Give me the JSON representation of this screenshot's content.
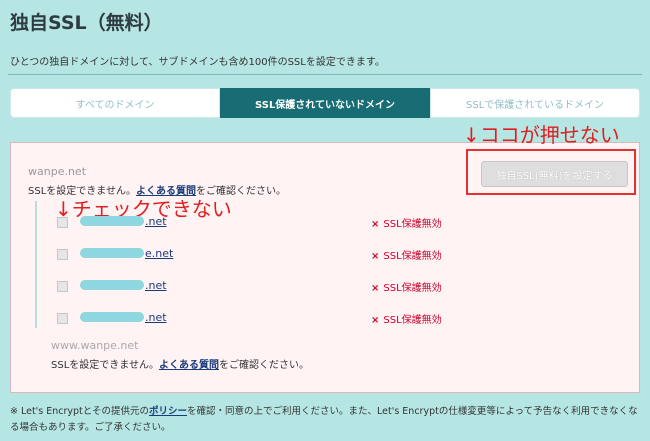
{
  "page_title": "独自SSL（無料）",
  "intro": "ひとつの独自ドメインに対して、サブドメインも含め100件のSSLを設定できます。",
  "tabs": [
    {
      "label": "すべてのドメイン"
    },
    {
      "label": "SSL保護されていないドメイン"
    },
    {
      "label": "SSLで保護されているドメイン"
    }
  ],
  "groups": [
    {
      "domain": "wanpe.net",
      "message_pre": "SSLを設定できません。",
      "faq_link": "よくある質問",
      "message_post": "をご確認ください。"
    },
    {
      "domain": "www.wanpe.net",
      "message_pre": "SSLを設定できません。",
      "faq_link": "よくある質問",
      "message_post": "をご確認ください。"
    }
  ],
  "set_ssl_button": "独自SSL(無料)を設定する",
  "annotations": {
    "cannot_press": "↓ココが押せない",
    "cannot_check": "↓チェックできない"
  },
  "subdomains": [
    {
      "visible_suffix": ".net",
      "status": "SSL保護無効"
    },
    {
      "visible_suffix": "e.net",
      "status": "SSL保護無効"
    },
    {
      "visible_suffix": ".net",
      "status": "SSL保護無効"
    },
    {
      "visible_suffix": ".net",
      "status": "SSL保護無効"
    }
  ],
  "status_icon": "×",
  "footer": {
    "pre": "※ Let's Encryptとその提供元の",
    "policy_link": "ポリシー",
    "post": "を確認・同意の上でご利用ください。また、Let's Encryptの仕様変更等によって予告なく利用できなくなる場合もあります。ご了承ください。"
  },
  "colors": {
    "background": "#b6e6e3",
    "active_tab": "#176d73",
    "panel": "#fff3f3",
    "annotation_red": "#e02020",
    "status_red": "#d0002a"
  }
}
